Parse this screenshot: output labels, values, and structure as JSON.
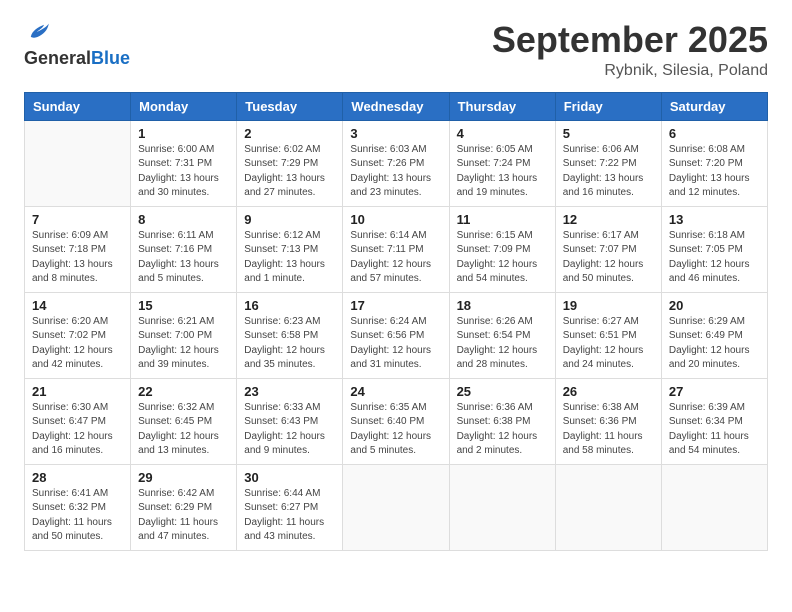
{
  "header": {
    "logo_general": "General",
    "logo_blue": "Blue",
    "month": "September 2025",
    "location": "Rybnik, Silesia, Poland"
  },
  "weekdays": [
    "Sunday",
    "Monday",
    "Tuesday",
    "Wednesday",
    "Thursday",
    "Friday",
    "Saturday"
  ],
  "weeks": [
    [
      {
        "day": "",
        "info": ""
      },
      {
        "day": "1",
        "info": "Sunrise: 6:00 AM\nSunset: 7:31 PM\nDaylight: 13 hours\nand 30 minutes."
      },
      {
        "day": "2",
        "info": "Sunrise: 6:02 AM\nSunset: 7:29 PM\nDaylight: 13 hours\nand 27 minutes."
      },
      {
        "day": "3",
        "info": "Sunrise: 6:03 AM\nSunset: 7:26 PM\nDaylight: 13 hours\nand 23 minutes."
      },
      {
        "day": "4",
        "info": "Sunrise: 6:05 AM\nSunset: 7:24 PM\nDaylight: 13 hours\nand 19 minutes."
      },
      {
        "day": "5",
        "info": "Sunrise: 6:06 AM\nSunset: 7:22 PM\nDaylight: 13 hours\nand 16 minutes."
      },
      {
        "day": "6",
        "info": "Sunrise: 6:08 AM\nSunset: 7:20 PM\nDaylight: 13 hours\nand 12 minutes."
      }
    ],
    [
      {
        "day": "7",
        "info": "Sunrise: 6:09 AM\nSunset: 7:18 PM\nDaylight: 13 hours\nand 8 minutes."
      },
      {
        "day": "8",
        "info": "Sunrise: 6:11 AM\nSunset: 7:16 PM\nDaylight: 13 hours\nand 5 minutes."
      },
      {
        "day": "9",
        "info": "Sunrise: 6:12 AM\nSunset: 7:13 PM\nDaylight: 13 hours\nand 1 minute."
      },
      {
        "day": "10",
        "info": "Sunrise: 6:14 AM\nSunset: 7:11 PM\nDaylight: 12 hours\nand 57 minutes."
      },
      {
        "day": "11",
        "info": "Sunrise: 6:15 AM\nSunset: 7:09 PM\nDaylight: 12 hours\nand 54 minutes."
      },
      {
        "day": "12",
        "info": "Sunrise: 6:17 AM\nSunset: 7:07 PM\nDaylight: 12 hours\nand 50 minutes."
      },
      {
        "day": "13",
        "info": "Sunrise: 6:18 AM\nSunset: 7:05 PM\nDaylight: 12 hours\nand 46 minutes."
      }
    ],
    [
      {
        "day": "14",
        "info": "Sunrise: 6:20 AM\nSunset: 7:02 PM\nDaylight: 12 hours\nand 42 minutes."
      },
      {
        "day": "15",
        "info": "Sunrise: 6:21 AM\nSunset: 7:00 PM\nDaylight: 12 hours\nand 39 minutes."
      },
      {
        "day": "16",
        "info": "Sunrise: 6:23 AM\nSunset: 6:58 PM\nDaylight: 12 hours\nand 35 minutes."
      },
      {
        "day": "17",
        "info": "Sunrise: 6:24 AM\nSunset: 6:56 PM\nDaylight: 12 hours\nand 31 minutes."
      },
      {
        "day": "18",
        "info": "Sunrise: 6:26 AM\nSunset: 6:54 PM\nDaylight: 12 hours\nand 28 minutes."
      },
      {
        "day": "19",
        "info": "Sunrise: 6:27 AM\nSunset: 6:51 PM\nDaylight: 12 hours\nand 24 minutes."
      },
      {
        "day": "20",
        "info": "Sunrise: 6:29 AM\nSunset: 6:49 PM\nDaylight: 12 hours\nand 20 minutes."
      }
    ],
    [
      {
        "day": "21",
        "info": "Sunrise: 6:30 AM\nSunset: 6:47 PM\nDaylight: 12 hours\nand 16 minutes."
      },
      {
        "day": "22",
        "info": "Sunrise: 6:32 AM\nSunset: 6:45 PM\nDaylight: 12 hours\nand 13 minutes."
      },
      {
        "day": "23",
        "info": "Sunrise: 6:33 AM\nSunset: 6:43 PM\nDaylight: 12 hours\nand 9 minutes."
      },
      {
        "day": "24",
        "info": "Sunrise: 6:35 AM\nSunset: 6:40 PM\nDaylight: 12 hours\nand 5 minutes."
      },
      {
        "day": "25",
        "info": "Sunrise: 6:36 AM\nSunset: 6:38 PM\nDaylight: 12 hours\nand 2 minutes."
      },
      {
        "day": "26",
        "info": "Sunrise: 6:38 AM\nSunset: 6:36 PM\nDaylight: 11 hours\nand 58 minutes."
      },
      {
        "day": "27",
        "info": "Sunrise: 6:39 AM\nSunset: 6:34 PM\nDaylight: 11 hours\nand 54 minutes."
      }
    ],
    [
      {
        "day": "28",
        "info": "Sunrise: 6:41 AM\nSunset: 6:32 PM\nDaylight: 11 hours\nand 50 minutes."
      },
      {
        "day": "29",
        "info": "Sunrise: 6:42 AM\nSunset: 6:29 PM\nDaylight: 11 hours\nand 47 minutes."
      },
      {
        "day": "30",
        "info": "Sunrise: 6:44 AM\nSunset: 6:27 PM\nDaylight: 11 hours\nand 43 minutes."
      },
      {
        "day": "",
        "info": ""
      },
      {
        "day": "",
        "info": ""
      },
      {
        "day": "",
        "info": ""
      },
      {
        "day": "",
        "info": ""
      }
    ]
  ]
}
